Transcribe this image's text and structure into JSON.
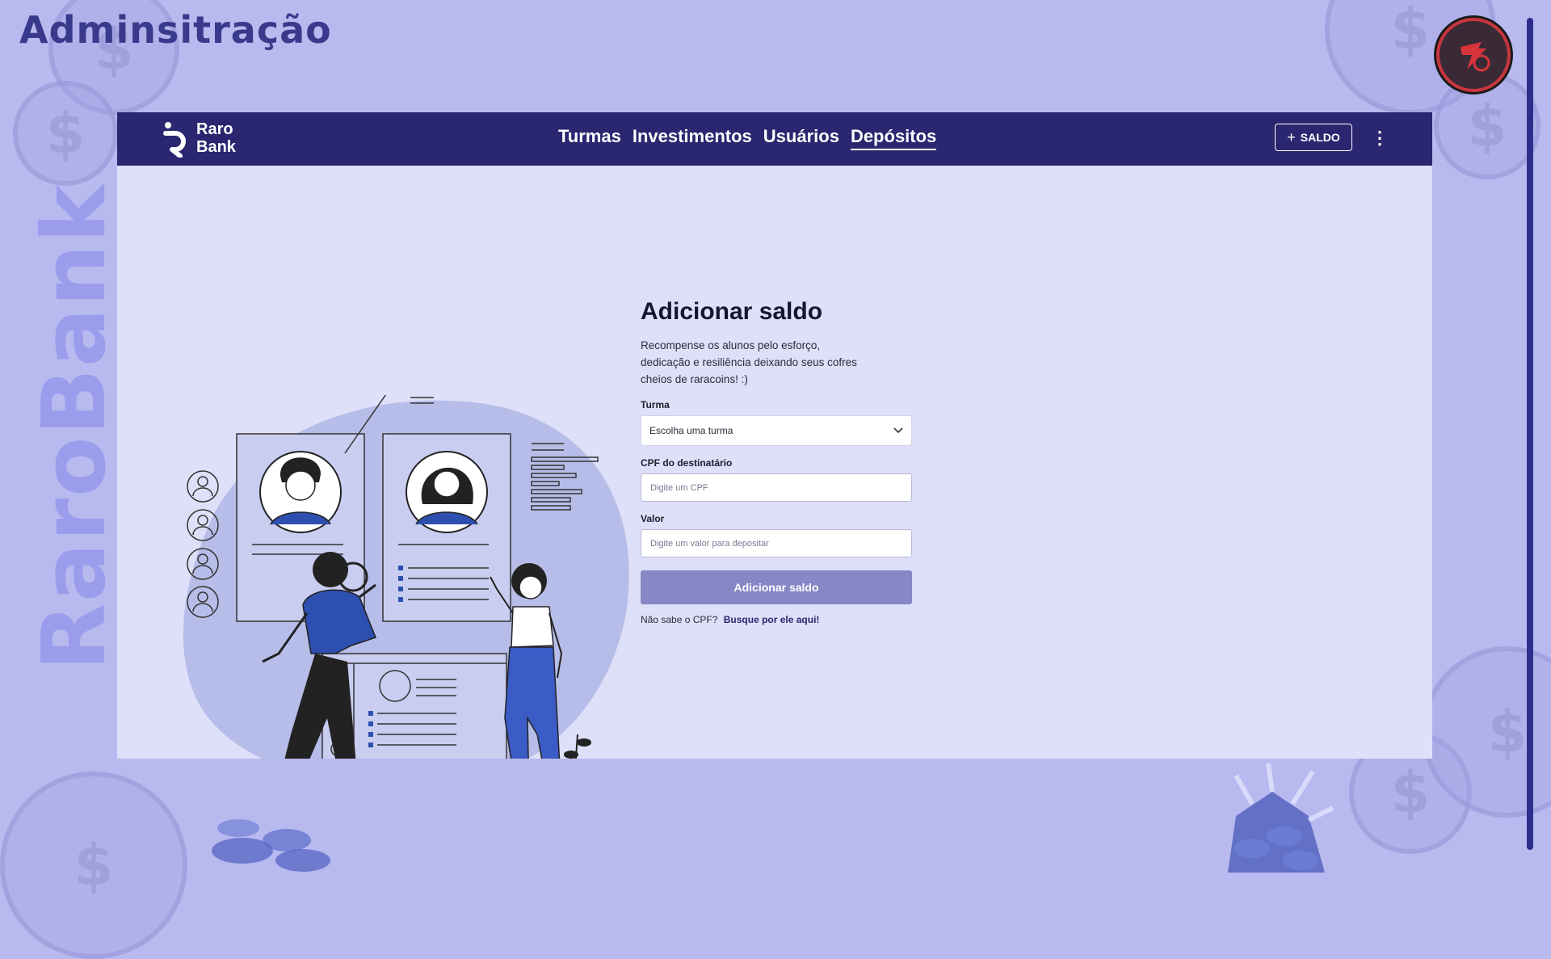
{
  "slide": {
    "title": "Adminsitração",
    "vertical_brand": "RaroBank"
  },
  "colors": {
    "navbar": "#2a2670",
    "page_background": "#b8b9ef",
    "app_background": "#dedff8",
    "accent_blue": "#3b5cc6",
    "button_disabled": "#8787c6"
  },
  "navbar": {
    "brand_line1": "Raro",
    "brand_line2": "Bank",
    "links": [
      {
        "label": "Turmas",
        "active": false
      },
      {
        "label": "Investimentos",
        "active": false
      },
      {
        "label": "Usuários",
        "active": false
      },
      {
        "label": "Depósitos",
        "active": true
      }
    ],
    "saldo_button": {
      "icon": "plus-icon",
      "label": "SALDO"
    },
    "more_icon": "kebab-menu-icon"
  },
  "form": {
    "title": "Adicionar saldo",
    "description": "Recompense os alunos pelo esforço, dedicação e resiliência deixando seus cofres cheios de raracoins! :)",
    "turma": {
      "label": "Turma",
      "selected": "Escolha uma turma",
      "icon": "chevron-down-icon"
    },
    "cpf": {
      "label": "CPF do destinatário",
      "placeholder": "Digite um CPF",
      "value": ""
    },
    "valor": {
      "label": "Valor",
      "placeholder": "Digite um valor para depositar",
      "value": ""
    },
    "submit_label": "Adicionar saldo",
    "help_text": "Não sabe o CPF?",
    "help_link": "Busque por ele aqui!"
  }
}
